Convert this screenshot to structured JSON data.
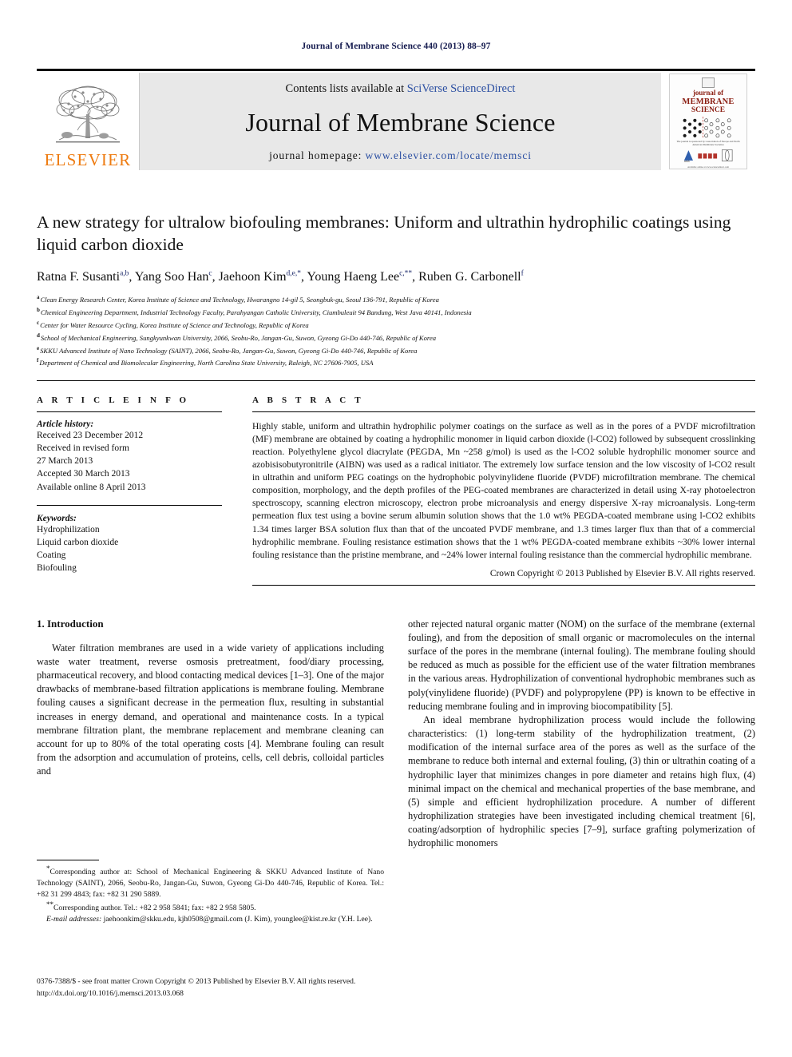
{
  "running_head": "Journal of Membrane Science 440 (2013) 88–97",
  "masthead": {
    "publisher_wordmark": "ELSEVIER",
    "contents_prefix": "Contents lists available at ",
    "contents_link": "SciVerse ScienceDirect",
    "journal_title": "Journal of Membrane Science",
    "homepage_prefix": "journal homepage: ",
    "homepage_url": "www.elsevier.com/locate/memsci",
    "cover": {
      "line1": "journal of",
      "line2": "MEMBRANE",
      "line3": "SCIENCE",
      "caption": "The journal is sponsored by: Association of Europe and North American Membrane Societies",
      "footer": "Available online at www.sciencedirect.com",
      "logo_left": "AMS",
      "logo_center": "nams",
      "logo_right": "EMS"
    },
    "accent_orange": "#ee7b10",
    "link_blue": "#2b4fa2",
    "panel_gray": "#e8e8e8"
  },
  "article": {
    "title": "A new strategy for ultralow biofouling membranes: Uniform and ultrathin hydrophilic coatings using liquid carbon dioxide",
    "authors": [
      {
        "name": "Ratna F. Susanti",
        "sup": "a,b",
        "sep": ", "
      },
      {
        "name": "Yang Soo Han",
        "sup": "c",
        "sep": ", "
      },
      {
        "name": "Jaehoon Kim",
        "sup": "d,e,*",
        "sep": ", "
      },
      {
        "name": "Young Haeng Lee",
        "sup": "c,**",
        "sep": ", "
      },
      {
        "name": "Ruben G. Carbonell",
        "sup": "f",
        "sep": ""
      }
    ],
    "affiliations": [
      {
        "mark": "a",
        "text": "Clean Energy Research Center, Korea Institute of Science and Technology, Hwarangno 14-gil 5, Seongbuk-gu, Seoul 136-791, Republic of Korea"
      },
      {
        "mark": "b",
        "text": "Chemical Engineering Department, Industrial Technology Faculty, Parahyangan Catholic University, Ciumbuleuit 94 Bandung, West Java 40141, Indonesia"
      },
      {
        "mark": "c",
        "text": "Center for Water Resource Cycling, Korea Institute of Science and Technology, Republic of Korea"
      },
      {
        "mark": "d",
        "text": "School of Mechanical Engineering, Sungkyunkwan University, 2066, Seobu-Ro, Jangan-Gu, Suwon, Gyeong Gi-Do 440-746, Republic of Korea"
      },
      {
        "mark": "e",
        "text": "SKKU Advanced Institute of Nano Technology (SAINT), 2066, Seobu-Ro, Jangan-Gu, Suwon, Gyeong Gi-Do 440-746, Republic of Korea"
      },
      {
        "mark": "f",
        "text": "Department of Chemical and Biomolecular Engineering, North Carolina State University, Raleigh, NC 27606-7905, USA"
      }
    ]
  },
  "article_info": {
    "heading": "A R T I C L E  I N F O",
    "history_label": "Article history:",
    "history": [
      "Received 23 December 2012",
      "Received in revised form",
      "27 March 2013",
      "Accepted 30 March 2013",
      "Available online 8 April 2013"
    ],
    "keywords_label": "Keywords:",
    "keywords": [
      "Hydrophilization",
      "Liquid carbon dioxide",
      "Coating",
      "Biofouling"
    ]
  },
  "abstract": {
    "heading": "A B S T R A C T",
    "text": "Highly stable, uniform and ultrathin hydrophilic polymer coatings on the surface as well as in the pores of a PVDF microfiltration (MF) membrane are obtained by coating a hydrophilic monomer in liquid carbon dioxide (l-CO2) followed by subsequent crosslinking reaction. Polyethylene glycol diacrylate (PEGDA, Mn ~258 g/mol) is used as the l-CO2 soluble hydrophilic monomer source and azobisisobutyronitrile (AIBN) was used as a radical initiator. The extremely low surface tension and the low viscosity of l-CO2 result in ultrathin and uniform PEG coatings on the hydrophobic polyvinylidene fluoride (PVDF) microfiltration membrane. The chemical composition, morphology, and the depth profiles of the PEG-coated membranes are characterized in detail using X-ray photoelectron spectroscopy, scanning electron microscopy, electron probe microanalysis and energy dispersive X-ray microanalysis. Long-term permeation flux test using a bovine serum albumin solution shows that the 1.0 wt% PEGDA-coated membrane using l-CO2 exhibits 1.34 times larger BSA solution flux than that of the uncoated PVDF membrane, and 1.3 times larger flux than that of a commercial hydrophilic membrane. Fouling resistance estimation shows that the 1 wt% PEGDA-coated membrane exhibits ~30% lower internal fouling resistance than the pristine membrane, and ~24% lower internal fouling resistance than the commercial hydrophilic membrane.",
    "copyright": "Crown Copyright © 2013 Published by Elsevier B.V. All rights reserved."
  },
  "body": {
    "section_heading": "1. Introduction",
    "left_paragraphs": [
      "Water filtration membranes are used in a wide variety of applications including waste water treatment, reverse osmosis pretreatment, food/diary processing, pharmaceutical recovery, and blood contacting medical devices [1–3]. One of the major drawbacks of membrane-based filtration applications is membrane fouling. Membrane fouling causes a significant decrease in the permeation flux, resulting in substantial increases in energy demand, and operational and maintenance costs. In a typical membrane filtration plant, the membrane replacement and membrane cleaning can account for up to 80% of the total operating costs [4]. Membrane fouling can result from the adsorption and accumulation of proteins, cells, cell debris, colloidal particles and"
    ],
    "right_paragraphs": [
      "other rejected natural organic matter (NOM) on the surface of the membrane (external fouling), and from the deposition of small organic or macromolecules on the internal surface of the pores in the membrane (internal fouling). The membrane fouling should be reduced as much as possible for the efficient use of the water filtration membranes in the various areas. Hydrophilization of conventional hydrophobic membranes such as poly(vinylidene fluoride) (PVDF) and polypropylene (PP) is known to be effective in reducing membrane fouling and in improving biocompatibility [5].",
      "An ideal membrane hydrophilization process would include the following characteristics: (1) long-term stability of the hydrophilization treatment, (2) modification of the internal surface area of the pores as well as the surface of the membrane to reduce both internal and external fouling, (3) thin or ultrathin coating of a hydrophilic layer that minimizes changes in pore diameter and retains high flux, (4) minimal impact on the chemical and mechanical properties of the base membrane, and (5) simple and efficient hydrophilization procedure. A number of different hydrophilization strategies have been investigated including chemical treatment [6], coating/adsorption of hydrophilic species [7–9], surface grafting polymerization of hydrophilic monomers"
    ]
  },
  "footnotes": {
    "line1": "Corresponding author at: School of Mechanical Engineering & SKKU Advanced Institute of Nano Technology (SAINT), 2066, Seobu-Ro, Jangan-Gu, Suwon, Gyeong Gi-Do 440-746, Republic of Korea. Tel.: +82 31 299 4843; fax: +82 31 290 5889.",
    "line2": "Corresponding author. Tel.: +82 2 958 5841; fax: +82 2 958 5805.",
    "email_label": "E-mail addresses:",
    "email_text": " jaehoonkim@skku.edu, kjh0508@gmail.com (J. Kim), younglee@kist.re.kr (Y.H. Lee)."
  },
  "bottom": {
    "line1": "0376-7388/$ - see front matter Crown Copyright © 2013 Published by Elsevier B.V. All rights reserved.",
    "line2": "http://dx.doi.org/10.1016/j.memsci.2013.03.068"
  }
}
